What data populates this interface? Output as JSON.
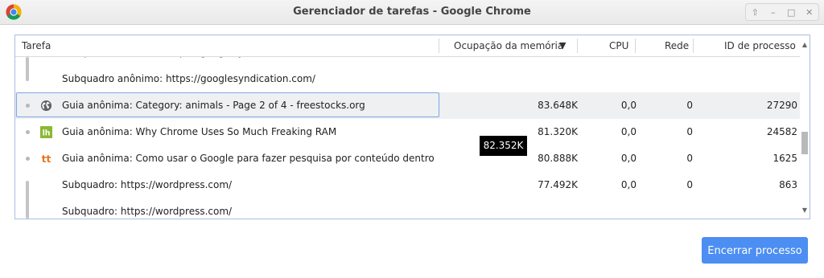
{
  "window": {
    "title": "Gerenciador de tarefas - Google Chrome",
    "controls": [
      "⇧",
      "–",
      "□",
      "✕"
    ]
  },
  "columns": {
    "task": "Tarefa",
    "memory": "Ocupação da memória",
    "memory_sort": "▼",
    "cpu": "CPU",
    "network": "Rede",
    "pid": "ID de processo"
  },
  "rows": [
    {
      "name": "Subquadro anônimo: https://googlesyndication.com",
      "memory": "",
      "cpu": "",
      "network": "",
      "pid": ""
    },
    {
      "name": "Subquadro anônimo: https://googlesyndication.com/",
      "memory": "",
      "cpu": "",
      "network": "",
      "pid": ""
    },
    {
      "name": "Guia anônima: Category: animals - Page 2 of 4 - freestocks.org",
      "icon": "globe-icon",
      "memory": "83.648K",
      "cpu": "0,0",
      "network": "0",
      "pid": "27290"
    },
    {
      "name": "Guia anônima: Why Chrome Uses So Much Freaking RAM",
      "icon": "lifehacker-icon",
      "memory": "81.320K",
      "cpu": "0,0",
      "network": "0",
      "pid": "24582"
    },
    {
      "name": "Guia anônima: Como usar o Google para fazer pesquisa por conteúdo dentro de um",
      "icon": "tecmundo-icon",
      "memory": "80.888K",
      "cpu": "0,0",
      "network": "0",
      "pid": "1625"
    },
    {
      "name": "Subquadro: https://wordpress.com/",
      "memory": "77.492K",
      "cpu": "0,0",
      "network": "0",
      "pid": "863"
    },
    {
      "name": "Subquadro: https://wordpress.com/",
      "memory": "",
      "cpu": "",
      "network": "",
      "pid": ""
    }
  ],
  "tooltip": "82.352K",
  "end_button": "Encerrar processo",
  "colors": {
    "accent": "#4c8ef2",
    "selection_outline": "#7ea6e5",
    "lifehacker_green": "#8ab834",
    "tecmundo_orange": "#e8731c"
  }
}
